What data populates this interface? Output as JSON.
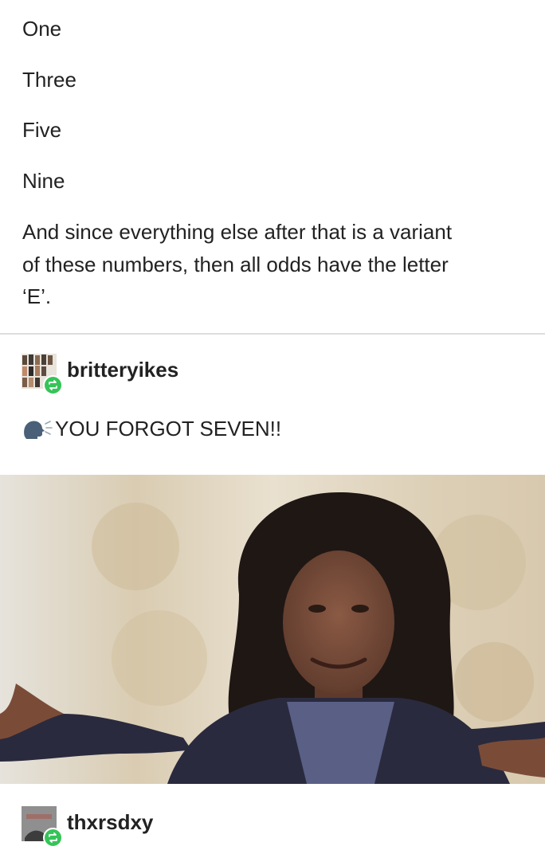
{
  "post": {
    "lines": [
      "One",
      "Three",
      "Five",
      "Nine"
    ],
    "paragraph_line_1": "And since everything else after that is a variant",
    "paragraph_line_2": "of these numbers, then all odds have the letter",
    "paragraph_line_3": "‘E’."
  },
  "reblogs": [
    {
      "username": "britteryikes",
      "avatar_icon": "photo-collage-avatar",
      "badge_icon": "reblog-icon",
      "badge_color": "#35c458",
      "message_icon": "speaking-head-icon",
      "message": "YOU FORGOT SEVEN!!",
      "media": "woman-shrugging-gif"
    },
    {
      "username": "thxrsdxy",
      "avatar_icon": "gray-photo-avatar",
      "badge_icon": "reblog-icon",
      "badge_color": "#35c458"
    }
  ],
  "colors": {
    "text": "#222222",
    "divider": "#dedede",
    "reblog_badge": "#35c458"
  }
}
